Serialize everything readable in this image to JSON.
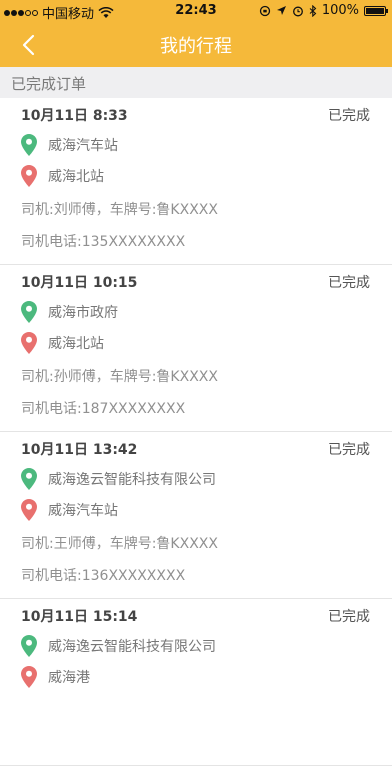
{
  "status_bar": {
    "carrier": "中国移动",
    "time": "22:43",
    "battery_text": "100%",
    "battery_level": 1.0
  },
  "nav": {
    "title": "我的行程",
    "back_icon": "chevron-left-icon"
  },
  "section": {
    "label": "已完成订单"
  },
  "colors": {
    "header": "#F5B93A",
    "pin_start": "#4CB97E",
    "pin_end": "#E8706E"
  },
  "orders": [
    {
      "time": "10月11日  8:33",
      "status": "已完成",
      "from": "威海汽车站",
      "to": "威海北站",
      "driver": "司机:刘师傅，车牌号:鲁KXXXX",
      "phone": "司机电话:135XXXXXXXX"
    },
    {
      "time": "10月11日  10:15",
      "status": "已完成",
      "from": "威海市政府",
      "to": "威海北站",
      "driver": "司机:孙师傅，车牌号:鲁KXXXX",
      "phone": "司机电话:187XXXXXXXX"
    },
    {
      "time": "10月11日  13:42",
      "status": "已完成",
      "from": "威海逸云智能科技有限公司",
      "to": "威海汽车站",
      "driver": "司机:王师傅，车牌号:鲁KXXXX",
      "phone": "司机电话:136XXXXXXXX"
    },
    {
      "time": "10月11日  15:14",
      "status": "已完成",
      "from": "威海逸云智能科技有限公司",
      "to": "威海港",
      "driver": "",
      "phone": ""
    }
  ]
}
